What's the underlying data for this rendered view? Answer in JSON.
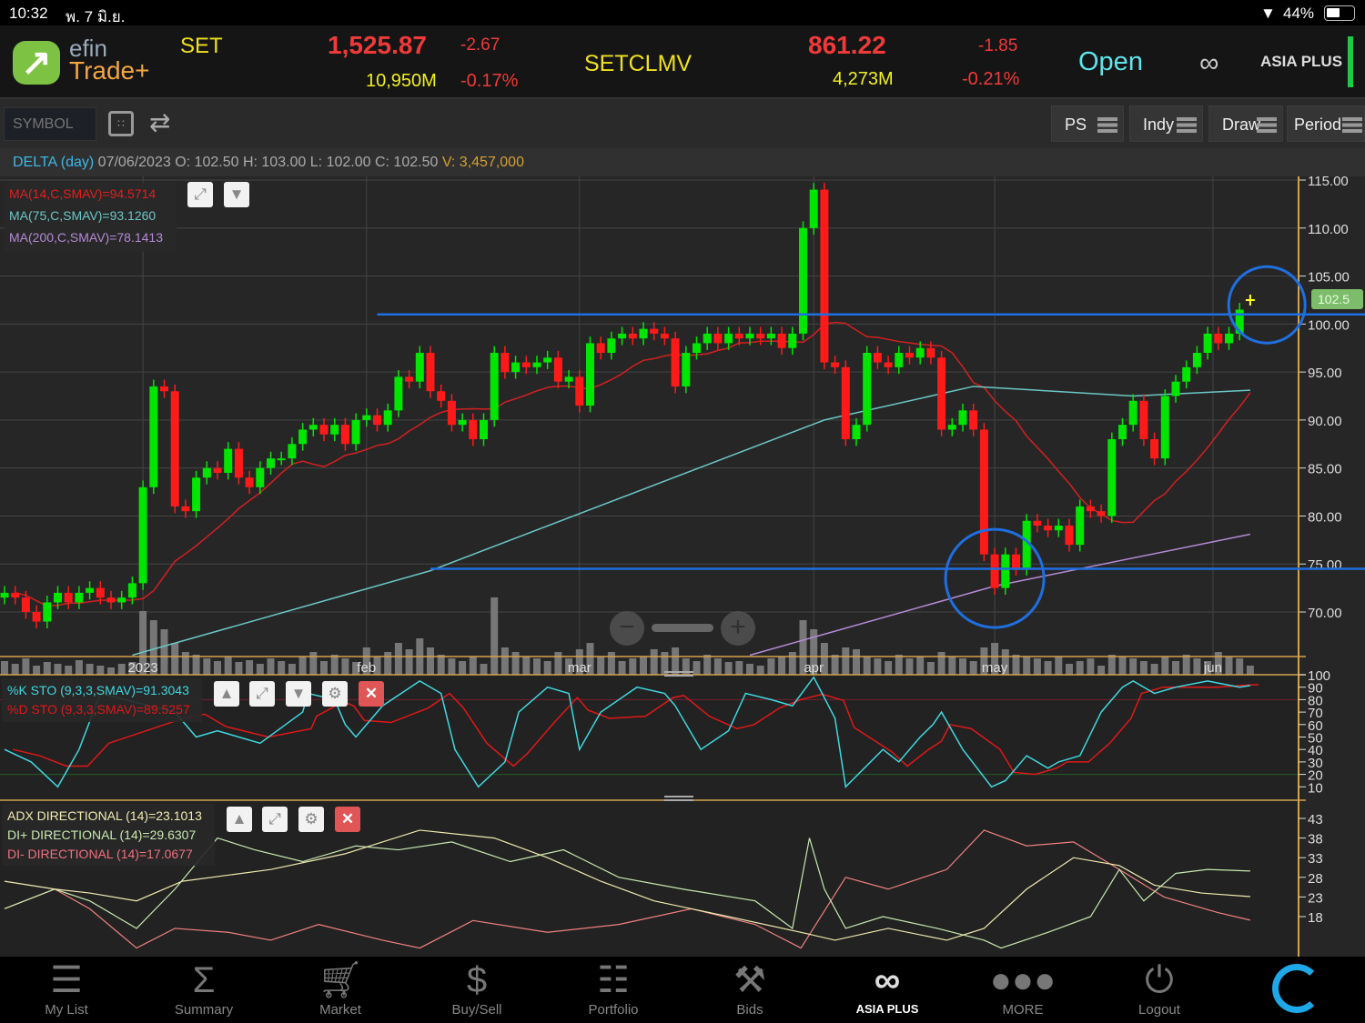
{
  "status_bar": {
    "time": "10:32",
    "date": "พ. 7 มิ.ย.",
    "battery": "44%",
    "battery_level": 0.44
  },
  "header": {
    "logo": {
      "line1": "efin",
      "line2": "Trade+"
    },
    "set": {
      "name": "SET",
      "value": "1,525.87",
      "change": "-2.67",
      "volume": "10,950M",
      "pct": "-0.17%"
    },
    "setclmv": {
      "name": "SETCLMV",
      "value": "861.22",
      "change": "-1.85",
      "volume": "4,273M",
      "pct": "-0.21%"
    },
    "market_status": "Open",
    "broker_logo": "ASIA PLUS"
  },
  "toolbar": {
    "symbol_placeholder": "SYMBOL",
    "buttons": [
      "PS",
      "Indy",
      "Draw",
      "Period"
    ]
  },
  "info": {
    "symbol": "DELTA (day)",
    "date": "07/06/2023",
    "o_label": "O:",
    "o": "102.50",
    "h_label": "H:",
    "h": "103.00",
    "l_label": "L:",
    "l": "102.00",
    "c_label": "C:",
    "c": "102.50",
    "v_label": "V:",
    "v": "3,457,000"
  },
  "legend_main": [
    "MA(14,C,SMAV)=94.5714",
    "MA(75,C,SMAV)=93.1260",
    "MA(200,C,SMAV)=78.1413"
  ],
  "legend_sto": [
    "%K STO (9,3,3,SMAV)=91.3043",
    "%D STO (9,3,3,SMAV)=89.5257"
  ],
  "legend_adx": [
    "ADX DIRECTIONAL (14)=23.1013",
    "DI+ DIRECTIONAL (14)=29.6307",
    "DI- DIRECTIONAL (14)=17.0677"
  ],
  "colors": {
    "up": "#00e600",
    "down": "#ff1a1a",
    "ma14": "#d42020",
    "ma75": "#6cc6c6",
    "ma200": "#b48ad6",
    "trendline": "#1f6fe0",
    "axis": "#d4a24a",
    "sto_k": "#3fd8e0",
    "sto_d": "#e01818",
    "adx": "#f0eab0",
    "di_plus": "#c8e8b0",
    "di_minus": "#f08080"
  },
  "chart_data": {
    "type": "candlestick",
    "price_ticks": [
      "115.00",
      "110.00",
      "105.00",
      "100.00",
      "95.00",
      "90.00",
      "85.00",
      "80.00",
      "75.00",
      "70.00"
    ],
    "ylim": [
      70,
      115
    ],
    "last_price_label": "102.5",
    "month_labels": [
      {
        "label": "2023",
        "session": 13
      },
      {
        "label": "feb",
        "session": 34
      },
      {
        "label": "mar",
        "session": 54
      },
      {
        "label": "apr",
        "session": 76
      },
      {
        "label": "may",
        "session": 93
      },
      {
        "label": "jun",
        "session": 113.5
      }
    ],
    "close": [
      72,
      71.5,
      70,
      69,
      71,
      72,
      71,
      72,
      72.5,
      71.5,
      71,
      71.5,
      73,
      83,
      93.5,
      93,
      81,
      80.5,
      84,
      85,
      84.5,
      87,
      84,
      83,
      85,
      86,
      86,
      87.5,
      89,
      89.5,
      88.5,
      89.5,
      87.5,
      90,
      90.5,
      89.5,
      91,
      94.5,
      94,
      97,
      93,
      92,
      89.5,
      90,
      88,
      90,
      97,
      95,
      96,
      95.5,
      96,
      96.5,
      94,
      94.5,
      91.5,
      98,
      97,
      98.5,
      99,
      98.5,
      99.5,
      99,
      98.5,
      93.5,
      97,
      98,
      99,
      98,
      99,
      98.5,
      99,
      98.5,
      99,
      97.5,
      99,
      110,
      114,
      96,
      95.5,
      88,
      89.5,
      97,
      96,
      95.5,
      97,
      96.5,
      97.5,
      96.5,
      89,
      89.5,
      91,
      89,
      76,
      72.5,
      76,
      74.5,
      79.5,
      79,
      78.5,
      79,
      77,
      81,
      80.5,
      80,
      88,
      89.5,
      92,
      88,
      86,
      92.5,
      94,
      95.5,
      97,
      99,
      98,
      99,
      101.5
    ],
    "last_doji": 102.5,
    "volume_relative": [
      15,
      12,
      18,
      10,
      14,
      12,
      10,
      16,
      12,
      10,
      8,
      12,
      14,
      70,
      60,
      50,
      35,
      25,
      22,
      18,
      15,
      20,
      14,
      16,
      12,
      18,
      15,
      12,
      20,
      25,
      15,
      22,
      18,
      14,
      30,
      20,
      25,
      35,
      28,
      40,
      30,
      22,
      18,
      15,
      20,
      12,
      85,
      30,
      25,
      20,
      18,
      15,
      25,
      18,
      28,
      35,
      20,
      25,
      15,
      18,
      20,
      28,
      25,
      30,
      18,
      15,
      22,
      18,
      14,
      15,
      12,
      10,
      18,
      20,
      25,
      60,
      50,
      35,
      22,
      30,
      28,
      20,
      18,
      15,
      22,
      18,
      20,
      14,
      25,
      20,
      18,
      15,
      30,
      35,
      28,
      22,
      20,
      18,
      15,
      20,
      12,
      15,
      18,
      10,
      22,
      20,
      18,
      15,
      12,
      20,
      15,
      22,
      18,
      15,
      25,
      20,
      18,
      10
    ],
    "ma75": [
      [
        12,
        65.5
      ],
      [
        40,
        74.3
      ],
      [
        77,
        90
      ],
      [
        91,
        93.5
      ],
      [
        106,
        92.5
      ],
      [
        117,
        93.1
      ]
    ],
    "ma200": [
      [
        70,
        65.5
      ],
      [
        93,
        72.7
      ],
      [
        117,
        78.1
      ]
    ],
    "trendlines": [
      {
        "value": 101,
        "from_session": 35
      },
      {
        "value": 74.5,
        "from_session": 40
      }
    ],
    "highlight_circles": [
      {
        "session": 116,
        "value": 102
      },
      {
        "session": 93,
        "value": 73.5
      }
    ],
    "sto_ticks": [
      "100",
      "90",
      "80",
      "70",
      "60",
      "50",
      "40",
      "30",
      "20",
      "10"
    ],
    "sto_k": [
      [
        0,
        40
      ],
      [
        2.5,
        30
      ],
      [
        5,
        10
      ],
      [
        7,
        40
      ],
      [
        9,
        85
      ],
      [
        16,
        70
      ],
      [
        18,
        50
      ],
      [
        20,
        55
      ],
      [
        24,
        45
      ],
      [
        28,
        70
      ],
      [
        28.5,
        85
      ],
      [
        31,
        80
      ],
      [
        32,
        60
      ],
      [
        33,
        50
      ],
      [
        35.5,
        75
      ],
      [
        39,
        95
      ],
      [
        41,
        85
      ],
      [
        42.3,
        40
      ],
      [
        44.5,
        10
      ],
      [
        47,
        30
      ],
      [
        48.3,
        70
      ],
      [
        51,
        90
      ],
      [
        53,
        85
      ],
      [
        54,
        40
      ],
      [
        56,
        70
      ],
      [
        59.4,
        90
      ],
      [
        62,
        85
      ],
      [
        63,
        75
      ],
      [
        65.4,
        40
      ],
      [
        68,
        55
      ],
      [
        69.6,
        85
      ],
      [
        72,
        80
      ],
      [
        74,
        75
      ],
      [
        76,
        98
      ],
      [
        78,
        65
      ],
      [
        79,
        10
      ],
      [
        82.5,
        40
      ],
      [
        84,
        30
      ],
      [
        86,
        50
      ],
      [
        87.2,
        60
      ],
      [
        88,
        70
      ],
      [
        90,
        40
      ],
      [
        92.7,
        10
      ],
      [
        94,
        15
      ],
      [
        96,
        35
      ],
      [
        98,
        25
      ],
      [
        99,
        30
      ],
      [
        101,
        35
      ],
      [
        103,
        70
      ],
      [
        105,
        90
      ],
      [
        106,
        95
      ],
      [
        108,
        85
      ],
      [
        110,
        90
      ],
      [
        113,
        95
      ],
      [
        116,
        90
      ],
      [
        117,
        91.3
      ]
    ],
    "adx_ticks": [
      "43",
      "38",
      "33",
      "28",
      "23",
      "18"
    ],
    "adx": [
      [
        0,
        27
      ],
      [
        4.7,
        25
      ],
      [
        8,
        24
      ],
      [
        12.4,
        22
      ],
      [
        16.7,
        27
      ],
      [
        25,
        30
      ],
      [
        32,
        34
      ],
      [
        39,
        40
      ],
      [
        46,
        38
      ],
      [
        51,
        33
      ],
      [
        56,
        27
      ],
      [
        61,
        22
      ],
      [
        68,
        18
      ],
      [
        74.8,
        14
      ],
      [
        78,
        12
      ],
      [
        83,
        15
      ],
      [
        88.5,
        12
      ],
      [
        92,
        15
      ],
      [
        96,
        25
      ],
      [
        100.4,
        33
      ],
      [
        104.7,
        31
      ],
      [
        108,
        26
      ],
      [
        112.4,
        24
      ],
      [
        117,
        23.1
      ]
    ],
    "di_plus": [
      [
        0,
        20
      ],
      [
        4.7,
        25
      ],
      [
        8,
        22
      ],
      [
        12.4,
        15
      ],
      [
        16,
        25
      ],
      [
        20,
        38
      ],
      [
        23.5,
        35
      ],
      [
        28,
        32
      ],
      [
        33,
        36
      ],
      [
        37,
        35
      ],
      [
        42,
        37
      ],
      [
        47.5,
        32
      ],
      [
        52.5,
        35
      ],
      [
        57.7,
        28
      ],
      [
        63.7,
        25
      ],
      [
        70.5,
        22
      ],
      [
        74,
        15
      ],
      [
        75.6,
        38
      ],
      [
        77,
        25
      ],
      [
        79,
        15
      ],
      [
        82.5,
        18
      ],
      [
        87.6,
        15
      ],
      [
        92,
        12
      ],
      [
        93.6,
        10
      ],
      [
        98,
        14
      ],
      [
        102,
        18
      ],
      [
        104.7,
        30
      ],
      [
        107,
        22
      ],
      [
        110,
        29
      ],
      [
        113,
        30
      ],
      [
        117,
        29.6
      ]
    ],
    "di_minus": [
      [
        0,
        20
      ],
      [
        4.7,
        25
      ],
      [
        8,
        20
      ],
      [
        12.4,
        10
      ],
      [
        16,
        15
      ],
      [
        21,
        14
      ],
      [
        25,
        12
      ],
      [
        29.5,
        16
      ],
      [
        35.5,
        12
      ],
      [
        39,
        10
      ],
      [
        44,
        17
      ],
      [
        51,
        14
      ],
      [
        57.7,
        16
      ],
      [
        64.5,
        20
      ],
      [
        70.5,
        16
      ],
      [
        74.8,
        10
      ],
      [
        79,
        28
      ],
      [
        83,
        25
      ],
      [
        88.5,
        30
      ],
      [
        92,
        40
      ],
      [
        96,
        36
      ],
      [
        100.4,
        37
      ],
      [
        104.7,
        30
      ],
      [
        108.9,
        23
      ],
      [
        114,
        19
      ],
      [
        117,
        17.1
      ]
    ]
  },
  "nav": [
    {
      "label": "My List",
      "icon": "list-icon"
    },
    {
      "label": "Summary",
      "icon": "sigma-icon"
    },
    {
      "label": "Market",
      "icon": "cart-icon"
    },
    {
      "label": "Buy/Sell",
      "icon": "dollar-exchange-icon"
    },
    {
      "label": "Portfolio",
      "icon": "document-icon"
    },
    {
      "label": "Bids",
      "icon": "gavel-icon"
    },
    {
      "label": "ASIA PLUS",
      "icon": "asiaplus-logo-icon"
    },
    {
      "label": "MORE",
      "icon": "more-dots-icon"
    },
    {
      "label": "Logout",
      "icon": "power-icon"
    }
  ]
}
